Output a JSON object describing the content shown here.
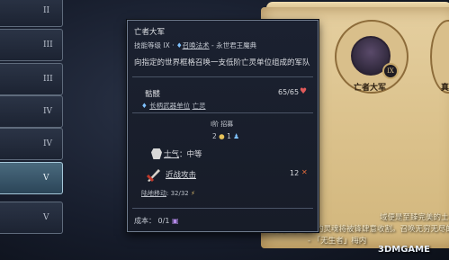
{
  "tiers": [
    {
      "label": "II",
      "active": false
    },
    {
      "label": "III",
      "active": false
    },
    {
      "label": "III",
      "active": false
    },
    {
      "label": "IV",
      "active": false
    },
    {
      "label": "IV",
      "active": false
    },
    {
      "label": "V",
      "active": true
    },
    {
      "label": "V",
      "active": false
    }
  ],
  "tooltip": {
    "title": "亡者大军",
    "level_prefix": "技能等级 IX · ",
    "school": "召唤法术",
    "level_suffix": " - 永世君王魔典",
    "description": "向指定的世界框格召唤一支低阶亡灵单位组成的军队",
    "unit_name": "骷髅",
    "hp": "65/65",
    "weapon_prefix": "长柄武器单位",
    "weapon_type": "亡灵",
    "tier_label": "I阶  招募",
    "stat_gold": "2",
    "stat_blue": "1",
    "morale_label": "士气",
    "morale_value": "：中等",
    "attack_label": "近战攻击",
    "attack_value": "12",
    "move_label": "陆地移动",
    "move_value": ": 32/32",
    "cost": "成本： 0/1"
  },
  "parchment": {
    "unit_name": "亡者大军",
    "unit_name_cut": "真",
    "badge": "IX",
    "lore_lines": [
      "域便是至臻完美的土地。死亡只会殿",
      "下的人，他们的灵魂将被锋肆意收割。召唤无穷无尽的大军，让暗影的时代降",
      "- 「无生者」梅内"
    ]
  },
  "watermark": "3DMGAME",
  "colors": {
    "accent": "#7fc2ff",
    "parchment": "#dcc38e",
    "panel": "#1b2130"
  }
}
